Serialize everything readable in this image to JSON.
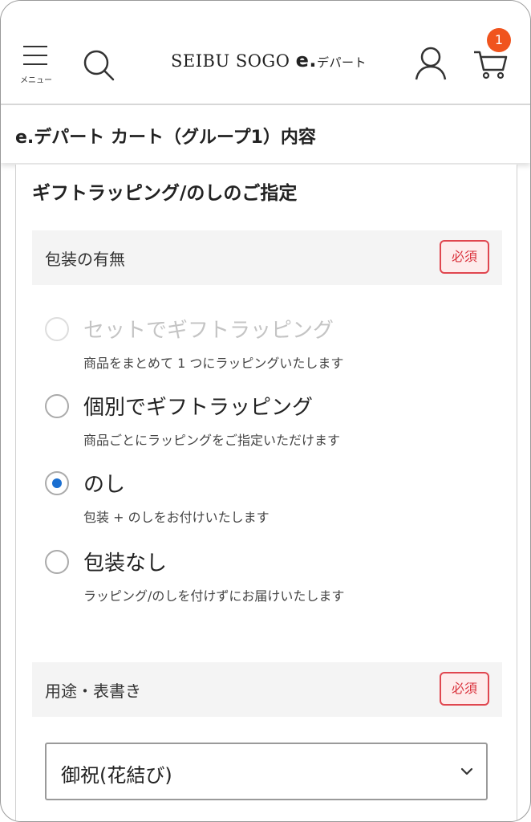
{
  "header": {
    "menu_label": "メニュー",
    "logo_brand": "SEIBU SOGO",
    "logo_e": "e.",
    "logo_suffix": "デパート",
    "cart_count": "1"
  },
  "subheader": {
    "title": "e.デパート カート（グループ1）内容"
  },
  "section": {
    "title": "ギフトラッピング/のしのご指定",
    "packaging": {
      "label": "包装の有無",
      "required_badge": "必須",
      "options": [
        {
          "title": "セットでギフトラッピング",
          "desc": "商品をまとめて 1 つにラッピングいたします",
          "state": "disabled"
        },
        {
          "title": "個別でギフトラッピング",
          "desc": "商品ごとにラッピングをご指定いただけます",
          "state": "unchecked"
        },
        {
          "title": "のし",
          "desc": "包装 + のしをお付けいたします",
          "state": "checked"
        },
        {
          "title": "包装なし",
          "desc": "ラッピング/のしを付けずにお届けいたします",
          "state": "unchecked"
        }
      ]
    },
    "usage": {
      "label": "用途・表書き",
      "required_badge": "必須",
      "selected_value": "御祝(花結び)"
    }
  },
  "colors": {
    "accent_radio": "#1a6fd1",
    "badge_orange": "#f0541e",
    "required_red": "#d9323c"
  },
  "icons": [
    "menu-icon",
    "search-icon",
    "user-icon",
    "cart-icon",
    "chevron-down-icon"
  ]
}
